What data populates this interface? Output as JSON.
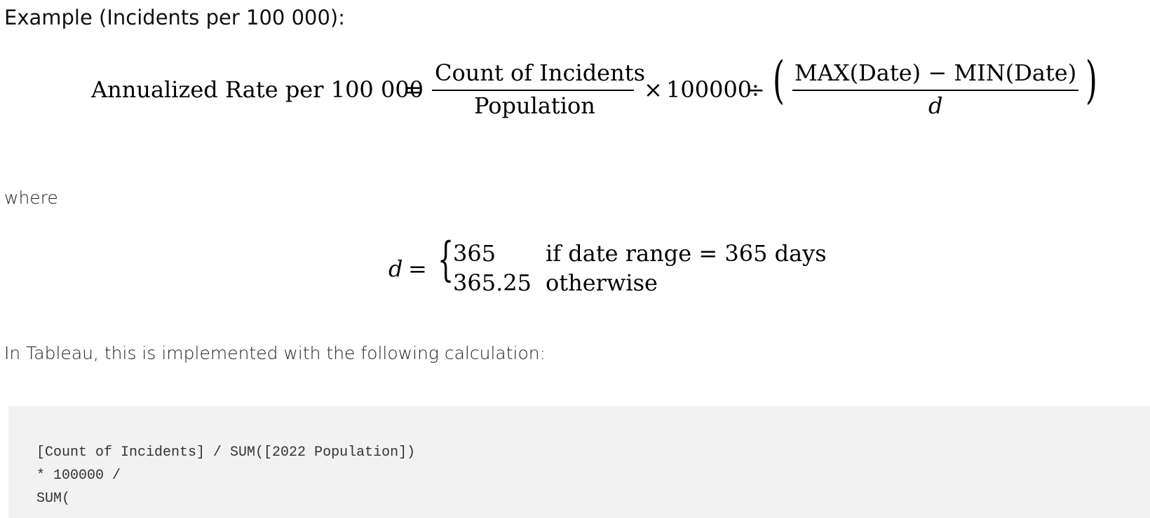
{
  "heading": "Example (Incidents per 100 000):",
  "formula": {
    "lhs": "Annualized Rate per 100 000",
    "equals": "=",
    "numerator": "Count of Incidents",
    "denominator": "Population",
    "times": "×",
    "constant": "100000",
    "divide": "÷",
    "open_paren": "(",
    "range_numerator": "MAX(Date) − MIN(Date)",
    "range_denominator": "d",
    "close_paren": ")"
  },
  "where_text": "where",
  "cases": {
    "lhs": "d",
    "equals": "=",
    "brace": "{",
    "case1_value": "365",
    "case1_condition": "if date range = 365 days",
    "case2_value": "365.25",
    "case2_condition": "otherwise"
  },
  "intro_text": "In Tableau, this is implemented with the following calculation:",
  "code_lines": [
    "[Count of Incidents] / SUM([2022 Population])",
    "* 100000 /",
    "SUM("
  ]
}
